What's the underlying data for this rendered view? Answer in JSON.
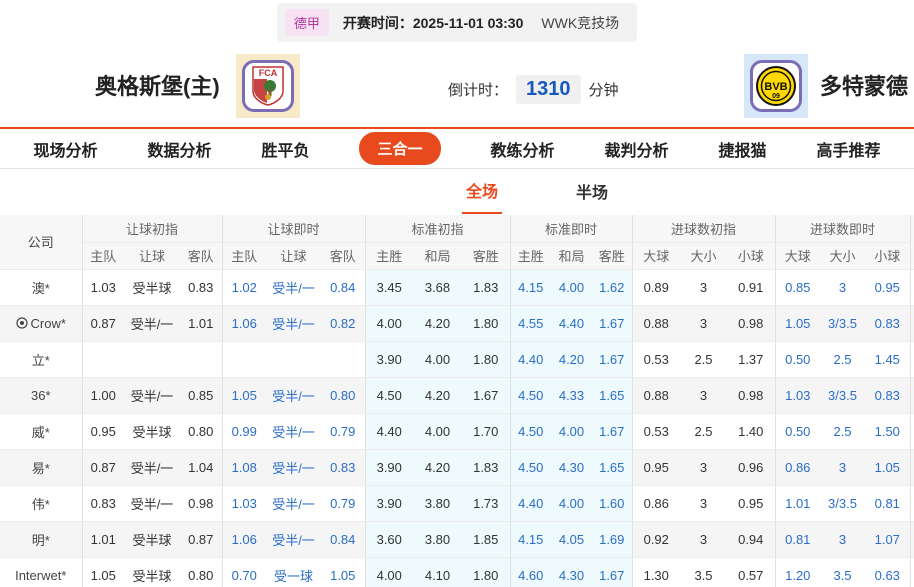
{
  "colors": {
    "accent": "#e8491d",
    "live_odds_blue": "#2a6dc9",
    "countdown_blue": "#1558c0",
    "league_badge_bg": "#f6e2f3",
    "league_badge_text": "#b0399f",
    "std_column_bg": "#eefafb",
    "row_stripe": "#f5f5f5"
  },
  "top_bar": {
    "league": "德甲",
    "kickoff": "开赛时间：2025-11-01 03:30",
    "venue": "WWK竞技场"
  },
  "match": {
    "home_name": "奥格斯堡(主)",
    "away_name": "多特蒙德",
    "home_logo": "FCA",
    "away_logo": "BVB",
    "away_logo_sub": "09",
    "countdown_label": "倒计时：",
    "countdown_value": "1310",
    "countdown_unit": "分钟"
  },
  "nav": {
    "tabs": [
      {
        "key": "live-analysis",
        "label": "现场分析",
        "active": false
      },
      {
        "key": "data-analysis",
        "label": "数据分析",
        "active": false
      },
      {
        "key": "win-draw-loss",
        "label": "胜平负",
        "active": false
      },
      {
        "key": "three-in-one",
        "label": "三合一",
        "active": true
      },
      {
        "key": "coach-analysis",
        "label": "教练分析",
        "active": false
      },
      {
        "key": "referee-analysis",
        "label": "裁判分析",
        "active": false
      },
      {
        "key": "jiebao-cat",
        "label": "捷报猫",
        "active": false
      },
      {
        "key": "expert-picks",
        "label": "高手推荐",
        "active": false
      }
    ]
  },
  "period_tabs": [
    {
      "key": "full-match",
      "label": "全场",
      "active": true
    },
    {
      "key": "half-match",
      "label": "半场",
      "active": false
    }
  ],
  "table": {
    "company_header": "公司",
    "groups": [
      {
        "label": "让球初指",
        "cols": [
          "主队",
          "让球",
          "客队"
        ]
      },
      {
        "label": "让球即时",
        "cols": [
          "主队",
          "让球",
          "客队"
        ]
      },
      {
        "label": "标准初指",
        "cols": [
          "主胜",
          "和局",
          "客胜"
        ]
      },
      {
        "label": "标准即时",
        "cols": [
          "主胜",
          "和局",
          "客胜"
        ]
      },
      {
        "label": "进球数初指",
        "cols": [
          "大球",
          "大小",
          "小球"
        ]
      },
      {
        "label": "进球数即时",
        "cols": [
          "大球",
          "大小",
          "小球"
        ]
      }
    ],
    "rows": [
      {
        "company": "澳*",
        "has_icon": false,
        "cells": [
          "1.03",
          "受半球",
          "0.83",
          "1.02",
          "受半/一",
          "0.84",
          "3.45",
          "3.68",
          "1.83",
          "4.15",
          "4.00",
          "1.62",
          "0.89",
          "3",
          "0.91",
          "0.85",
          "3",
          "0.95"
        ]
      },
      {
        "company": "Crow*",
        "has_icon": true,
        "cells": [
          "0.87",
          "受半/一",
          "1.01",
          "1.06",
          "受半/一",
          "0.82",
          "4.00",
          "4.20",
          "1.80",
          "4.55",
          "4.40",
          "1.67",
          "0.88",
          "3",
          "0.98",
          "1.05",
          "3/3.5",
          "0.83"
        ]
      },
      {
        "company": "立*",
        "has_icon": false,
        "cells": [
          "",
          "",
          "",
          "",
          "",
          "",
          "3.90",
          "4.00",
          "1.80",
          "4.40",
          "4.20",
          "1.67",
          "0.53",
          "2.5",
          "1.37",
          "0.50",
          "2.5",
          "1.45"
        ]
      },
      {
        "company": "36*",
        "has_icon": false,
        "cells": [
          "1.00",
          "受半/一",
          "0.85",
          "1.05",
          "受半/一",
          "0.80",
          "4.50",
          "4.20",
          "1.67",
          "4.50",
          "4.33",
          "1.65",
          "0.88",
          "3",
          "0.98",
          "1.03",
          "3/3.5",
          "0.83"
        ]
      },
      {
        "company": "威*",
        "has_icon": false,
        "cells": [
          "0.95",
          "受半球",
          "0.80",
          "0.99",
          "受半/一",
          "0.79",
          "4.40",
          "4.00",
          "1.70",
          "4.50",
          "4.00",
          "1.67",
          "0.53",
          "2.5",
          "1.40",
          "0.50",
          "2.5",
          "1.50"
        ]
      },
      {
        "company": "易*",
        "has_icon": false,
        "cells": [
          "0.87",
          "受半/一",
          "1.04",
          "1.08",
          "受半/一",
          "0.83",
          "3.90",
          "4.20",
          "1.83",
          "4.50",
          "4.30",
          "1.65",
          "0.95",
          "3",
          "0.96",
          "0.86",
          "3",
          "1.05"
        ]
      },
      {
        "company": "伟*",
        "has_icon": false,
        "cells": [
          "0.83",
          "受半/一",
          "0.98",
          "1.03",
          "受半/一",
          "0.79",
          "3.90",
          "3.80",
          "1.73",
          "4.40",
          "4.00",
          "1.60",
          "0.86",
          "3",
          "0.95",
          "1.01",
          "3/3.5",
          "0.81"
        ]
      },
      {
        "company": "明*",
        "has_icon": false,
        "cells": [
          "1.01",
          "受半球",
          "0.87",
          "1.06",
          "受半/一",
          "0.84",
          "3.60",
          "3.80",
          "1.85",
          "4.15",
          "4.05",
          "1.69",
          "0.92",
          "3",
          "0.94",
          "0.81",
          "3",
          "1.07"
        ]
      },
      {
        "company": "Interwet*",
        "has_icon": false,
        "cells": [
          "1.05",
          "受半球",
          "0.80",
          "0.70",
          "受一球",
          "1.05",
          "4.00",
          "4.10",
          "1.80",
          "4.60",
          "4.30",
          "1.67",
          "1.30",
          "3.5",
          "0.57",
          "1.20",
          "3.5",
          "0.63"
        ]
      }
    ]
  }
}
